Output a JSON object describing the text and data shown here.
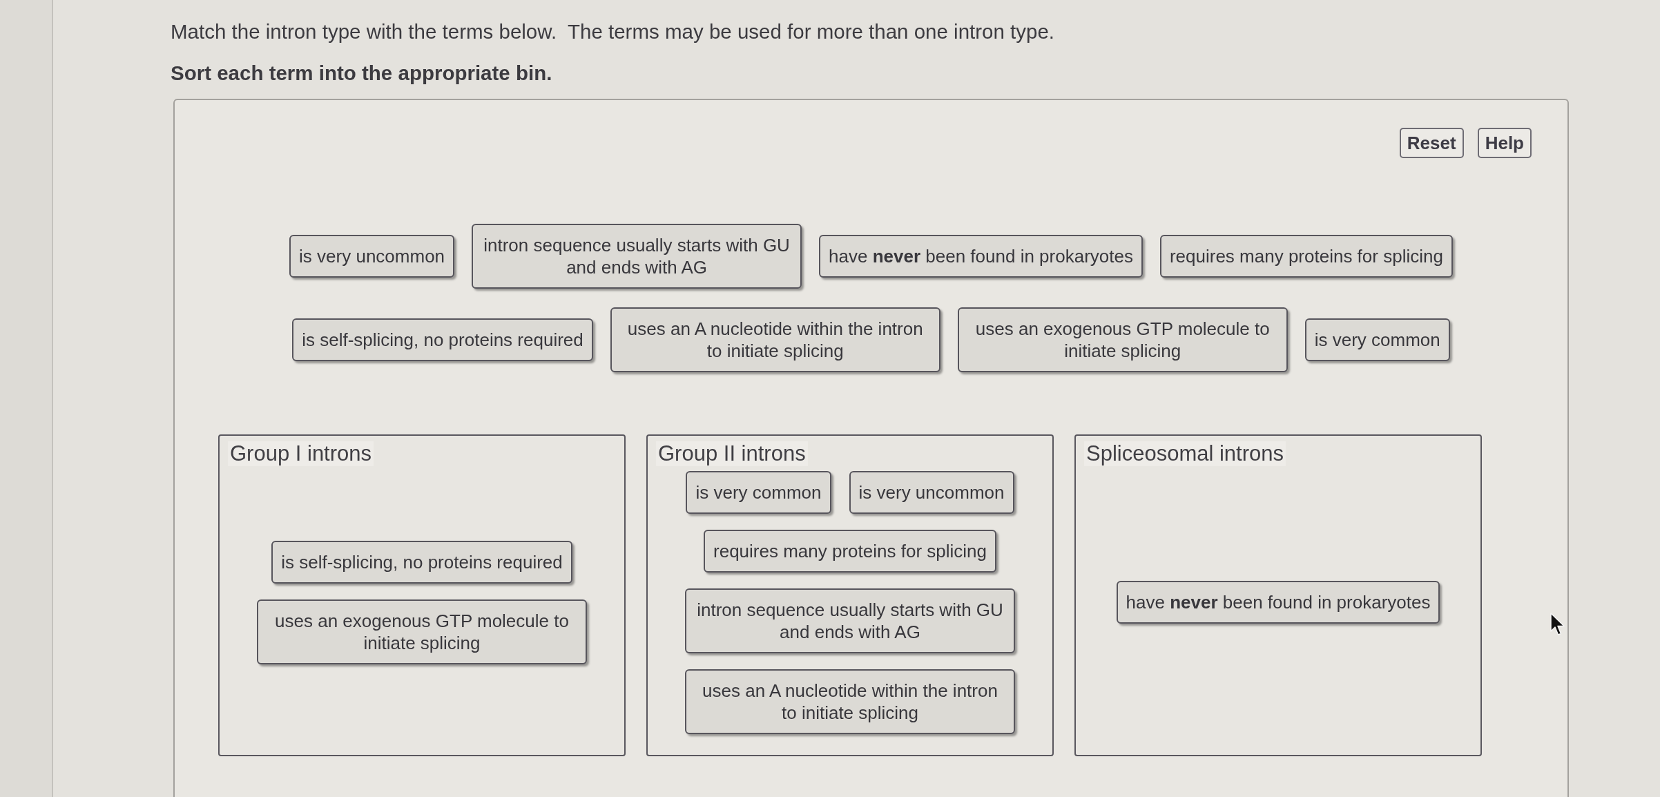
{
  "instructions": {
    "prompt": "Match the intron type with the terms below.  The terms may be used for more than one intron type.",
    "task": "Sort each term into the appropriate bin."
  },
  "buttons": [
    {
      "label": "Reset"
    },
    {
      "label": "Help"
    }
  ],
  "term_pool": {
    "rows": [
      [
        {
          "text": "is very uncommon"
        },
        {
          "text": "intron sequence usually starts with GU and ends with AG"
        },
        {
          "text": "have **never** been found in prokaryotes"
        },
        {
          "text": "requires many proteins for splicing"
        }
      ],
      [
        {
          "text": "is self-splicing, no proteins required"
        },
        {
          "text": "uses an A nucleotide within the intron to initiate splicing"
        },
        {
          "text": "uses an exogenous GTP molecule to initiate splicing"
        },
        {
          "text": "is very common"
        }
      ]
    ]
  },
  "bins": [
    {
      "title": "Group I introns",
      "terms": [
        {
          "text": "is self-splicing, no proteins required"
        },
        {
          "text": "uses an exogenous GTP molecule to initiate splicing"
        }
      ]
    },
    {
      "title": "Group II introns",
      "terms": [
        {
          "text": "is very common"
        },
        {
          "text": "is very uncommon"
        },
        {
          "text": "requires many proteins for splicing"
        },
        {
          "text": "intron sequence usually starts with GU and ends with AG"
        },
        {
          "text": "uses an A nucleotide within the intron to initiate splicing"
        }
      ]
    },
    {
      "title": "Spliceosomal introns",
      "terms": [
        {
          "text": "have **never** been found in prokaryotes"
        }
      ]
    }
  ]
}
